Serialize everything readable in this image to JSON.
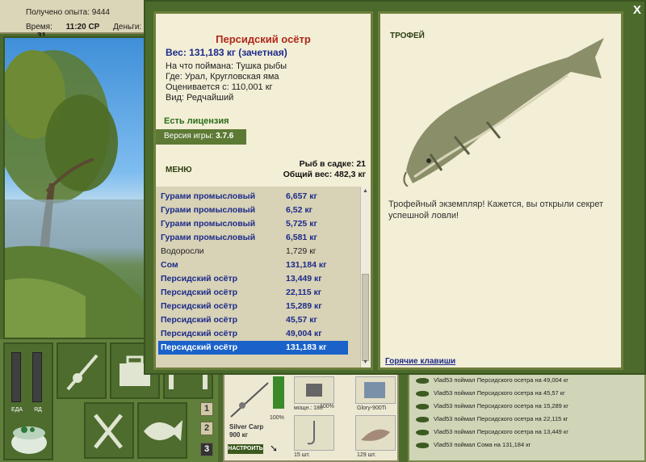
{
  "status": {
    "experience_label": "Получено опыта: 9444",
    "time_label": "Время:",
    "time_value": "11:20 СР",
    "money_label": "Деньги:",
    "money_value": "31"
  },
  "left_controls": {
    "gauge1_label": "ЕДА",
    "gauge2_label": "ЯД",
    "buttons": [
      "1",
      "2",
      "3"
    ]
  },
  "tackle": {
    "rod_name": "Silver Carp",
    "rod_weight": "900 кг",
    "rod_percent": "100%",
    "reel_label": "мощн.: 180",
    "reel_percent": "100%",
    "line_label": "Glory-900Ti",
    "hook_count": "15 шт.",
    "bait_count": "129 шт.",
    "setup_button": "НАСТРОИТЬ"
  },
  "log": {
    "entries": [
      "Vlad53 поймал Персидского осетра на 49,004 кг",
      "Vlad53 поймал Персидского осетра на 45,57 кг",
      "Vlad53 поймал Персидского осетра на 15,289 кг",
      "Vlad53 поймал Персидского осетра на 22,115 кг",
      "Vlad53 поймал Персидского осетра на 13,449 кг",
      "Vlad53 поймал Сома на 131,184 кг"
    ]
  },
  "modal": {
    "close_label": "X",
    "fish": {
      "name": "Персидский осётр",
      "weight": "Вес: 131,183 кг (зачетная)",
      "caught_on": "На что поймана: Тушка рыбы",
      "location": "Где: Урал, Кругловская яма",
      "rated_from": "Оценивается с: 110,001 кг",
      "kind": "Вид: Редчайший"
    },
    "license": "Есть лицензия",
    "version_label": "Версия игры:",
    "version_value": "3.7.6",
    "menu_label": "МЕНЮ",
    "keepnet_count": "Рыб в садке: 21",
    "keepnet_total": "Общий вес: 482,3 кг",
    "catches": [
      {
        "name": "Гурами промысловый",
        "weight": "6,657 кг",
        "bold": true
      },
      {
        "name": "Гурами промысловый",
        "weight": "6,52 кг",
        "bold": true
      },
      {
        "name": "Гурами промысловый",
        "weight": "5,725 кг",
        "bold": true
      },
      {
        "name": "Гурами промысловый",
        "weight": "6,581 кг",
        "bold": true
      },
      {
        "name": "Водоросли",
        "weight": "1,729 кг",
        "bold": false
      },
      {
        "name": "Сом",
        "weight": "131,184 кг",
        "bold": true
      },
      {
        "name": "Персидский осётр",
        "weight": "13,449 кг",
        "bold": true
      },
      {
        "name": "Персидский осётр",
        "weight": "22,115 кг",
        "bold": true
      },
      {
        "name": "Персидский осётр",
        "weight": "15,289 кг",
        "bold": true
      },
      {
        "name": "Персидский осётр",
        "weight": "45,57 кг",
        "bold": true
      },
      {
        "name": "Персидский осётр",
        "weight": "49,004 кг",
        "bold": true
      },
      {
        "name": "Персидский осётр",
        "weight": "131,183 кг",
        "bold": true,
        "selected": true
      }
    ],
    "trophy_title": "ТРОФЕЙ",
    "trophy_description": "Трофейный экземпляр! Кажется, вы открыли секрет успешной ловли!",
    "hotkeys_label": "Горячие клавиши"
  }
}
